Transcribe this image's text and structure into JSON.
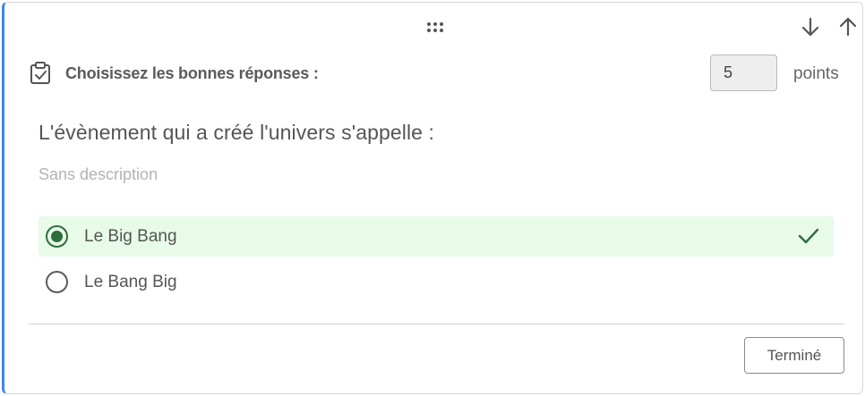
{
  "question_card": {
    "header": {
      "title": "Choisissez les bonnes réponses :",
      "icon": "clipboard-check-icon"
    },
    "points": {
      "value": "5",
      "label": "points"
    },
    "question": {
      "title": "L'évènement qui a créé l'univers s'appelle :",
      "description": "Sans description"
    },
    "options": [
      {
        "label": "Le Big Bang",
        "selected": true,
        "correct": true
      },
      {
        "label": "Le Bang Big",
        "selected": false,
        "correct": false
      }
    ],
    "actions": {
      "done_label": "Terminé"
    },
    "toolbar_icons": [
      "drag-handle-icon",
      "arrow-down-icon",
      "arrow-up-icon"
    ]
  },
  "colors": {
    "accent_border": "#3d87ea",
    "correct_bg": "#e7fbe8",
    "correct_fg": "#2f6d3a"
  }
}
